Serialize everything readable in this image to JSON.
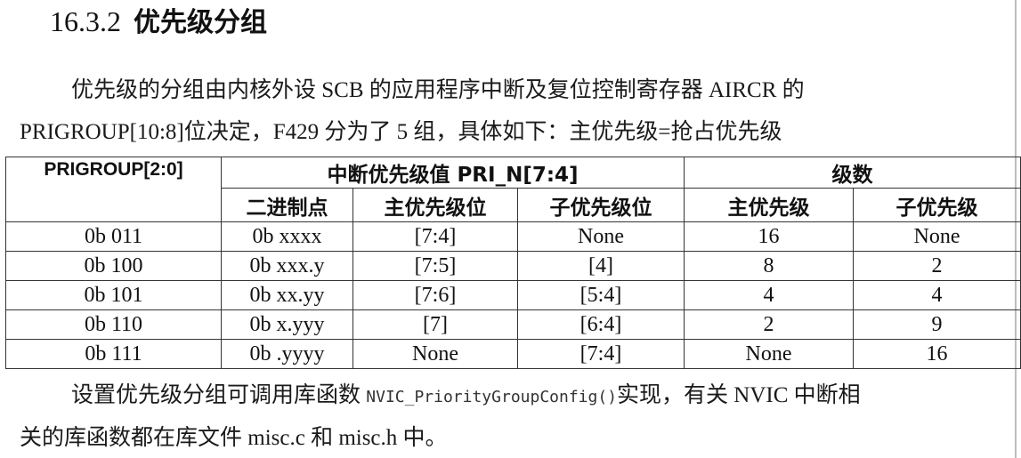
{
  "section": {
    "number": "16.3.2",
    "title": "优先级分组"
  },
  "intro": {
    "line1": "优先级的分组由内核外设 SCB 的应用程序中断及复位控制寄存器 AIRCR 的",
    "line2": "PRIGROUP[10:8]位决定，F429 分为了 5 组，具体如下：主优先级=抢占优先级"
  },
  "table": {
    "header": {
      "prigroup": "PRIGROUP[2:0]",
      "pri_n": "中断优先级值 PRI_N[7:4]",
      "levels": "级数",
      "binary_point": "二进制点",
      "main_bits": "主优先级位",
      "sub_bits": "子优先级位",
      "main_levels": "主优先级",
      "sub_levels": "子优先级"
    },
    "rows": [
      {
        "prigroup": "0b 011",
        "binary_point": "0b xxxx",
        "main_bits": "[7:4]",
        "sub_bits": "None",
        "main_levels": "16",
        "sub_levels": "None"
      },
      {
        "prigroup": "0b 100",
        "binary_point": "0b xxx.y",
        "main_bits": "[7:5]",
        "sub_bits": "[4]",
        "main_levels": "8",
        "sub_levels": "2"
      },
      {
        "prigroup": "0b 101",
        "binary_point": "0b xx.yy",
        "main_bits": "[7:6]",
        "sub_bits": "[5:4]",
        "main_levels": "4",
        "sub_levels": "4"
      },
      {
        "prigroup": "0b 110",
        "binary_point": "0b x.yyy",
        "main_bits": "[7]",
        "sub_bits": "[6:4]",
        "main_levels": "2",
        "sub_levels": "9"
      },
      {
        "prigroup": "0b 111",
        "binary_point": "0b .yyyy",
        "main_bits": "None",
        "sub_bits": "[7:4]",
        "main_levels": "None",
        "sub_levels": "16"
      }
    ]
  },
  "outro": {
    "line1_before": "设置优先级分组可调用库函数 ",
    "line1_code": "NVIC_PriorityGroupConfig()",
    "line1_after": "实现，有关 NVIC 中断相",
    "line2": "关的库函数都在库文件 misc.c 和 misc.h 中。"
  }
}
